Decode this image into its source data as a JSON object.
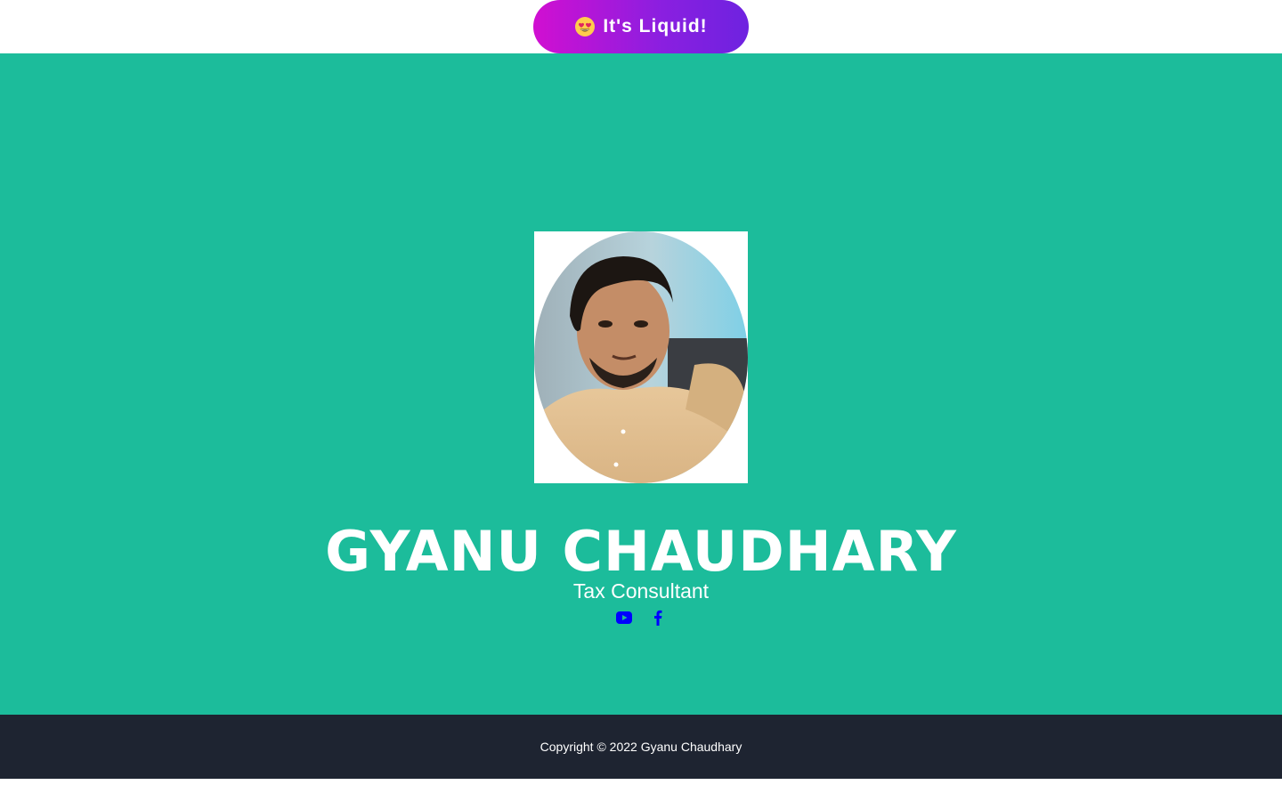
{
  "banner": {
    "label": "It's Liquid!",
    "emoji_icon": "heart-eyes-emoji-icon",
    "gradient": [
      "#d10fd1",
      "#6e22e0"
    ]
  },
  "hero": {
    "background": "#1cbc9b",
    "photo_alt": "Gyanu Chaudhary",
    "name": "GYANU CHAUDHARY",
    "role": "Tax Consultant",
    "socials": [
      {
        "icon": "youtube-icon",
        "color": "#0000ff"
      },
      {
        "icon": "facebook-icon",
        "color": "#0000ff"
      }
    ]
  },
  "footer": {
    "background": "#1e2431",
    "copyright": "Copyright © 2022 Gyanu Chaudhary"
  }
}
